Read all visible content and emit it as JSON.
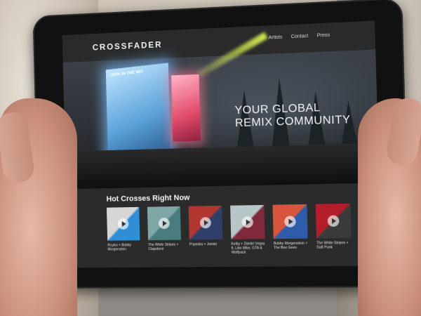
{
  "site": {
    "logo": "CROSSFADER",
    "nav": [
      "Artists",
      "Contact",
      "Press"
    ]
  },
  "hero": {
    "title": "YOUR GLOBAL\nREMIX COMMUNITY",
    "screen_text": "100% IN THE MIX"
  },
  "hot_crosses": {
    "title": "Hot Crosses Right Now",
    "items": [
      {
        "caption": "Royksi + Bobby Morgenstein",
        "colors": [
          "#d6d6d6",
          "#2f8fd6"
        ]
      },
      {
        "caption": "The White Stripes + Clapstone",
        "colors": [
          "#7fa7a8",
          "#4a7c7d"
        ]
      },
      {
        "caption": "Popeska + Joeski",
        "colors": [
          "#b1362f",
          "#2f3f6a"
        ]
      },
      {
        "caption": "Kelby + Dimitri Vegas ft. Like Mike, GTA & Wolfpack",
        "colors": [
          "#b7c6c8",
          "#7e2a3c"
        ]
      },
      {
        "caption": "Bobby Morgenstein + The Bee Gees",
        "colors": [
          "#d7553c",
          "#2e5caa"
        ]
      },
      {
        "caption": "The White Stripes + Daft Punk",
        "colors": [
          "#b21e2a",
          "#3a3a3a"
        ]
      }
    ]
  }
}
